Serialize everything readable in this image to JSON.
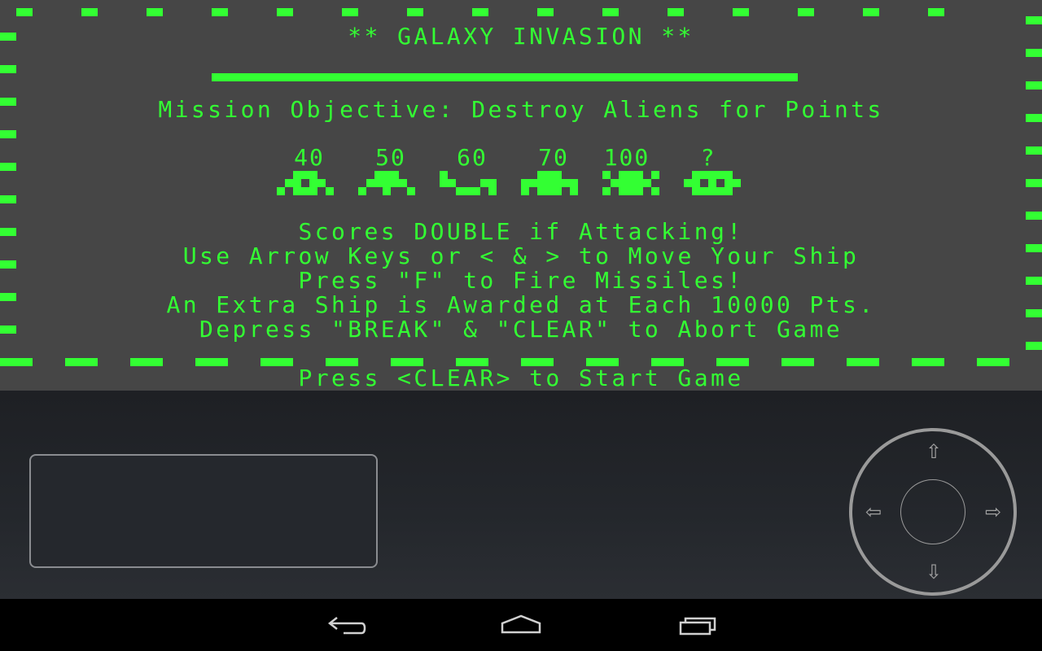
{
  "game": {
    "title": "** GALAXY INVASION **",
    "objective": "Mission Objective: Destroy Aliens for Points",
    "scores": [
      "40",
      "50",
      "60",
      "70",
      "100",
      "?"
    ],
    "instructions": [
      "Scores DOUBLE if Attacking!",
      "Use Arrow Keys or < & > to Move Your Ship",
      "Press \"F\" to Fire Missiles!",
      "An Extra Ship is Awarded at Each 10000 Pts.",
      "Depress \"BREAK\" & \"CLEAR\" to Abort Game"
    ],
    "start_prompt": "Press <CLEAR> to Start Game",
    "phosphor_color": "#33ff33",
    "screen_color": "#464646"
  },
  "controls": {
    "joystick_arrows": {
      "up": "⇧",
      "down": "⇩",
      "left": "⇦",
      "right": "⇨"
    }
  },
  "navbar": {
    "icons": [
      "back-icon",
      "home-icon",
      "recent-apps-icon"
    ]
  }
}
